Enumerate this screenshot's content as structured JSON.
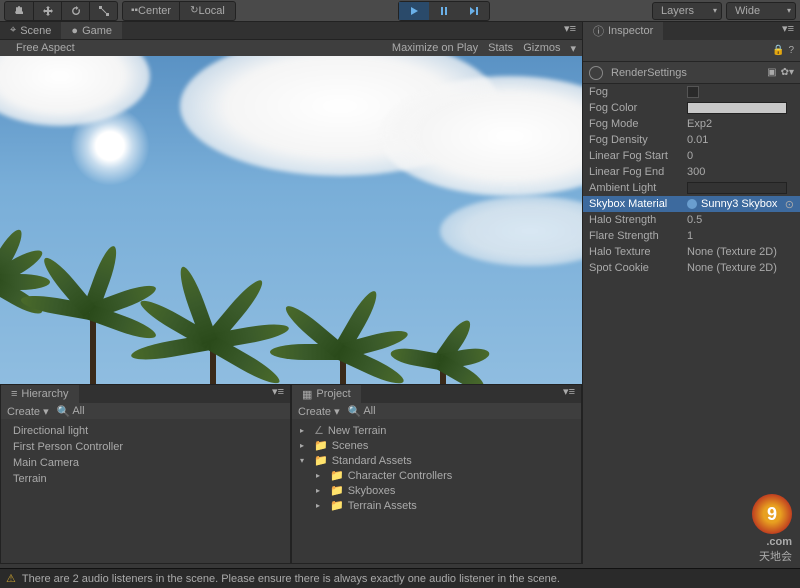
{
  "toolbar": {
    "pivot_center": "Center",
    "pivot_local": "Local",
    "layers": "Layers",
    "layout": "Wide"
  },
  "tabs": {
    "scene": "Scene",
    "game": "Game"
  },
  "game_toolbar": {
    "aspect": "Free Aspect",
    "maximize": "Maximize on Play",
    "stats": "Stats",
    "gizmos": "Gizmos"
  },
  "hierarchy": {
    "tab": "Hierarchy",
    "create": "Create",
    "search": "All",
    "items": [
      "Directional light",
      "First Person Controller",
      "Main Camera",
      "Terrain"
    ]
  },
  "project": {
    "tab": "Project",
    "create": "Create",
    "search": "All",
    "items": [
      {
        "indent": 0,
        "arrow": "▸",
        "icon": "∠",
        "label": "New Terrain"
      },
      {
        "indent": 0,
        "arrow": "▸",
        "icon": "📁",
        "label": "Scenes"
      },
      {
        "indent": 0,
        "arrow": "▾",
        "icon": "📁",
        "label": "Standard Assets"
      },
      {
        "indent": 1,
        "arrow": "▸",
        "icon": "📁",
        "label": "Character Controllers"
      },
      {
        "indent": 1,
        "arrow": "▸",
        "icon": "📁",
        "label": "Skyboxes"
      },
      {
        "indent": 1,
        "arrow": "▸",
        "icon": "📁",
        "label": "Terrain Assets"
      }
    ]
  },
  "inspector": {
    "tab": "Inspector",
    "title": "RenderSettings",
    "props": [
      {
        "label": "Fog",
        "type": "checkbox"
      },
      {
        "label": "Fog Color",
        "type": "color"
      },
      {
        "label": "Fog Mode",
        "value": "Exp2"
      },
      {
        "label": "Fog Density",
        "value": "0.01"
      },
      {
        "label": "Linear Fog Start",
        "value": "0"
      },
      {
        "label": "Linear Fog End",
        "value": "300"
      },
      {
        "label": "Ambient Light",
        "type": "color-dark"
      },
      {
        "label": "Skybox Material",
        "value": "Sunny3 Skybox",
        "type": "material",
        "selected": true
      },
      {
        "label": "Halo Strength",
        "value": "0.5"
      },
      {
        "label": "Flare Strength",
        "value": "1"
      },
      {
        "label": "Halo Texture",
        "value": "None (Texture 2D)"
      },
      {
        "label": "Spot Cookie",
        "value": "None (Texture 2D)"
      }
    ]
  },
  "statusbar": {
    "message": "There are 2 audio listeners in the scene. Please ensure there is always exactly one audio listener in the scene."
  },
  "watermark": {
    "site": ".com",
    "sub1": "天地会",
    "sub2": "天地会"
  }
}
